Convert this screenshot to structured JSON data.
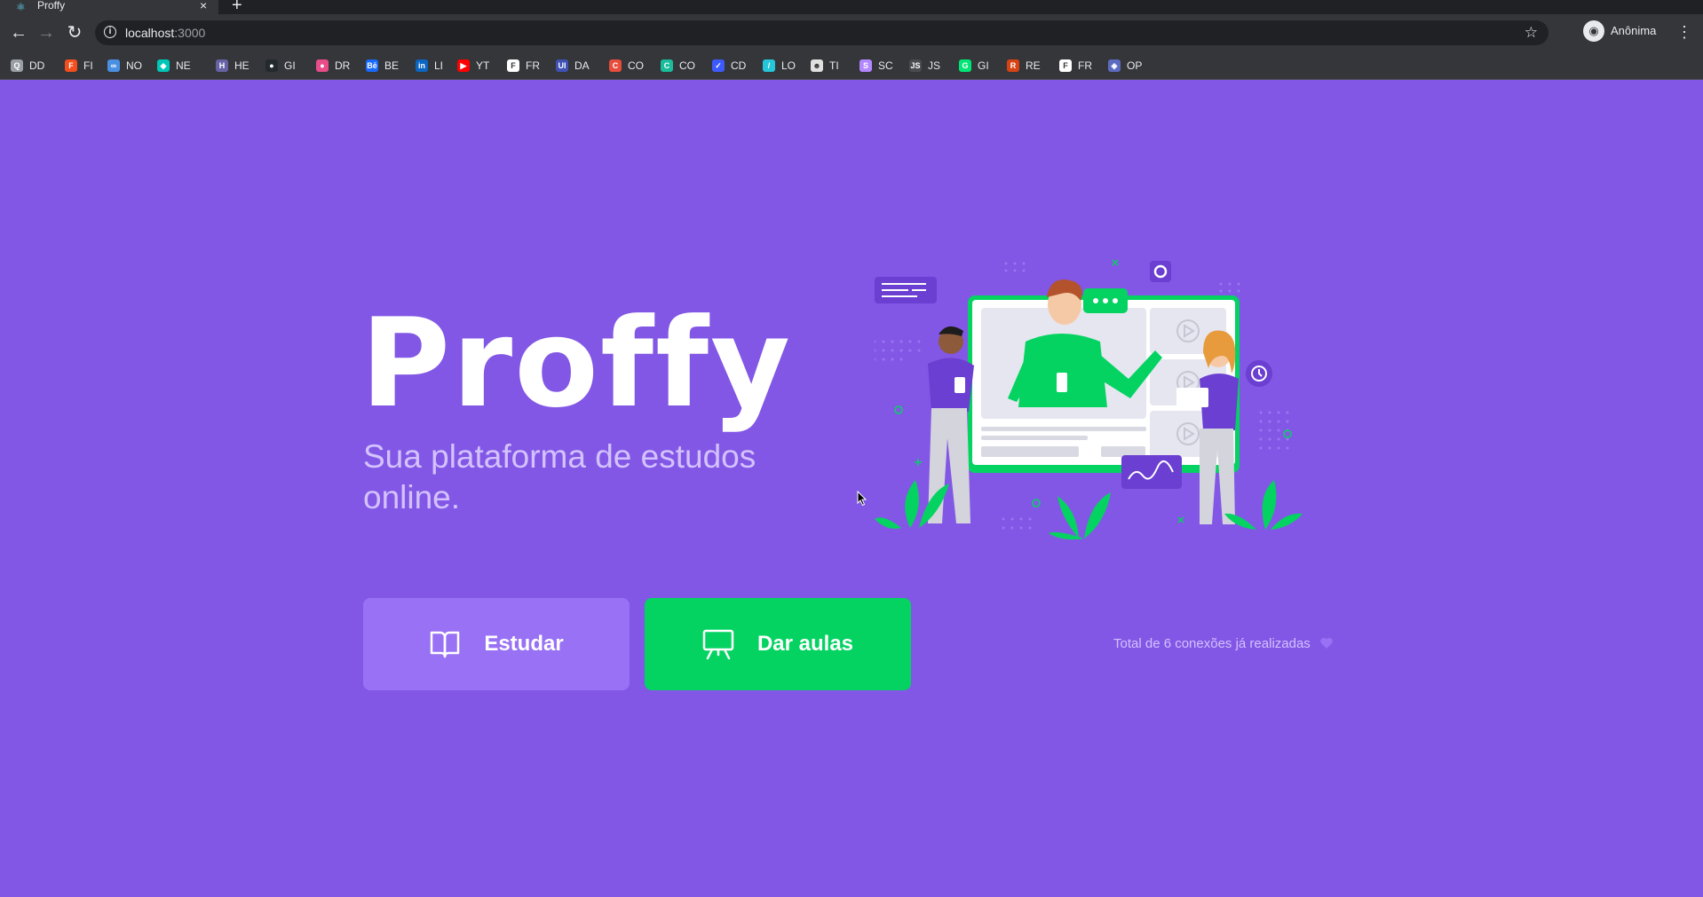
{
  "browser": {
    "tab": {
      "title": "Proffy",
      "favicon": "react-icon"
    },
    "nav": {
      "back": "arrow-left-icon",
      "forward": "arrow-right-icon",
      "reload": "reload-icon"
    },
    "address": {
      "host": "localhost",
      "port": ":3000"
    },
    "profile": {
      "label": "Anônima"
    },
    "bookmarks": [
      {
        "label": "DD",
        "color": "#9aa0a6",
        "glyph": "Q"
      },
      {
        "label": "FI",
        "color": "#f24e1e",
        "glyph": "F"
      },
      {
        "label": "NO",
        "color": "#4a90e2",
        "glyph": "∞"
      },
      {
        "label": "NE",
        "color": "#00c7b7",
        "glyph": "◆"
      },
      {
        "label": "HE",
        "color": "#6762a6",
        "glyph": "H"
      },
      {
        "label": "GI",
        "color": "#24292e",
        "glyph": "●"
      },
      {
        "label": "DR",
        "color": "#ea4c89",
        "glyph": "●"
      },
      {
        "label": "BE",
        "color": "#1769ff",
        "glyph": "Bē"
      },
      {
        "label": "LI",
        "color": "#0a66c2",
        "glyph": "in"
      },
      {
        "label": "YT",
        "color": "#ff0000",
        "glyph": "▶"
      },
      {
        "label": "FR",
        "color": "#ffffff",
        "glyph": "F"
      },
      {
        "label": "DA",
        "color": "#3f51b5",
        "glyph": "UI"
      },
      {
        "label": "CO",
        "color": "#e74c3c",
        "glyph": "C"
      },
      {
        "label": "CO",
        "color": "#1abc9c",
        "glyph": "C"
      },
      {
        "label": "CD",
        "color": "#3d5afe",
        "glyph": "✓"
      },
      {
        "label": "LO",
        "color": "#26c6da",
        "glyph": "/"
      },
      {
        "label": "TI",
        "color": "#e0e0e0",
        "glyph": "☻"
      },
      {
        "label": "SC",
        "color": "#b388ff",
        "glyph": "S"
      },
      {
        "label": "JS",
        "color": "#4a4b4f",
        "glyph": "JS"
      },
      {
        "label": "GI",
        "color": "#00e676",
        "glyph": "G"
      },
      {
        "label": "RE",
        "color": "#d84315",
        "glyph": "R"
      },
      {
        "label": "FR",
        "color": "#ffffff",
        "glyph": "F"
      },
      {
        "label": "OP",
        "color": "#5c6bc0",
        "glyph": "◈"
      }
    ]
  },
  "page": {
    "logo": "Proffy",
    "subtitle": "Sua plataforma de estudos online.",
    "buttons": {
      "study": {
        "label": "Estudar",
        "icon": "book-icon"
      },
      "teach": {
        "label": "Dar aulas",
        "icon": "presentation-icon"
      }
    },
    "connections": {
      "text": "Total de 6 conexões já realizadas",
      "icon": "purple-heart-icon"
    },
    "hero_image": "landing-illustration",
    "colors": {
      "background": "#8257e5",
      "study_button": "#9871f5",
      "teach_button": "#04d361",
      "text_muted": "#d4c2ff"
    }
  }
}
